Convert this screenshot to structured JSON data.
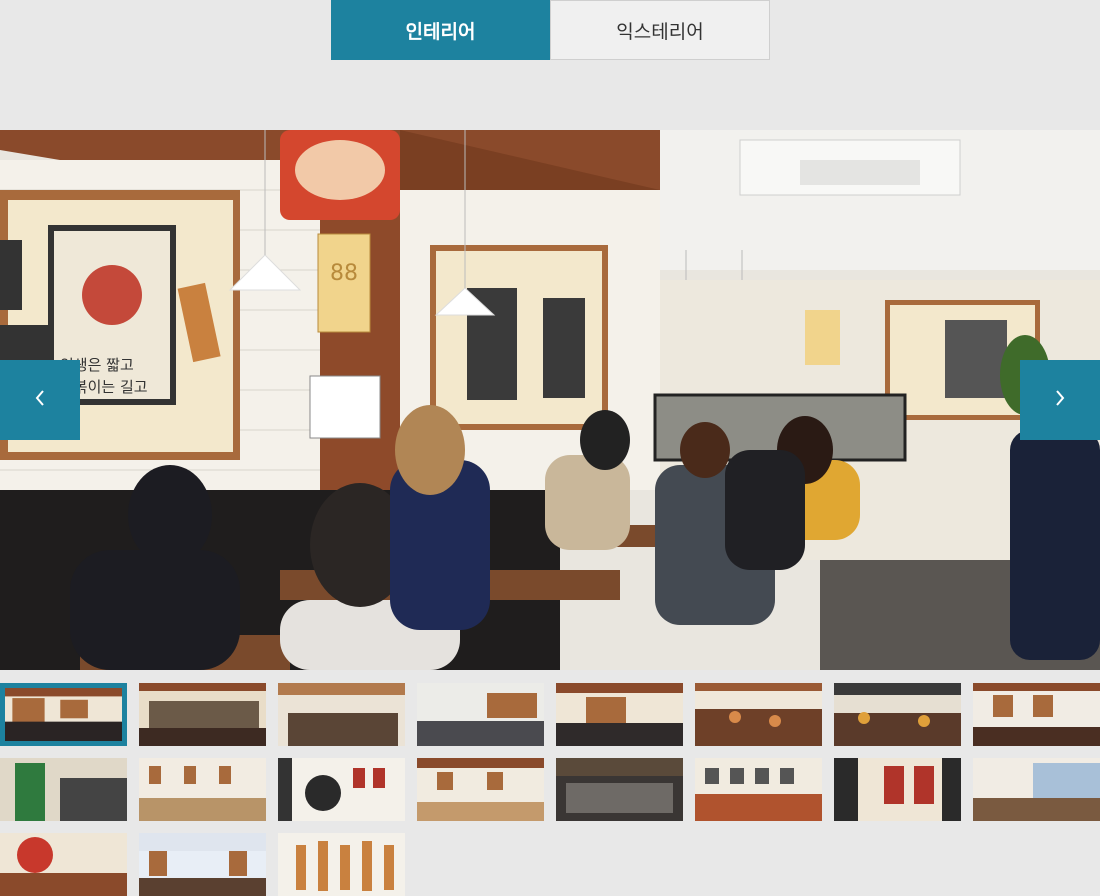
{
  "tabs": {
    "interior": "인테리어",
    "exterior": "익스테리어",
    "active": "interior"
  },
  "gallery": {
    "prev_icon": "chevron-left-icon",
    "next_icon": "chevron-right-icon",
    "selected_index": 0,
    "thumbnail_count": 19
  },
  "colors": {
    "accent": "#1d829f",
    "background": "#e8e8e8"
  }
}
